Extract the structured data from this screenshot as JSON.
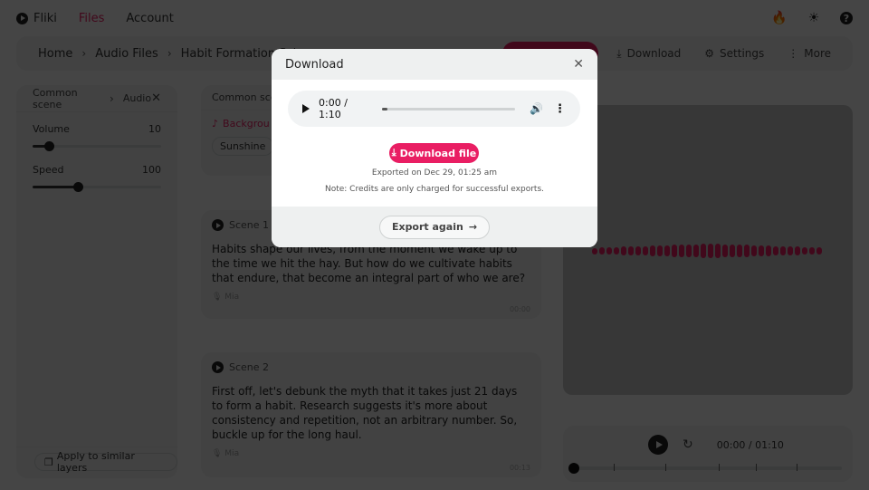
{
  "app": {
    "brand": "Fliki",
    "nav": [
      {
        "label": "Files",
        "active": true
      },
      {
        "label": "Account",
        "active": false
      }
    ],
    "top_icons": [
      "flame-icon",
      "sun-icon",
      "help-icon"
    ]
  },
  "breadcrumb": {
    "items": [
      "Home",
      "Audio Files",
      "Habit Formation Scien"
    ],
    "separator": "›",
    "actions": [
      {
        "label": "Download",
        "icon": "download-icon"
      },
      {
        "label": "Settings",
        "icon": "gear-icon"
      },
      {
        "label": "More",
        "icon": "more-vertical-icon"
      }
    ]
  },
  "left_panel": {
    "crumb": [
      "Common scene",
      "Audio"
    ],
    "close": "✕",
    "sliders": [
      {
        "label": "Volume",
        "value": "10",
        "fraction": 0.13
      },
      {
        "label": "Speed",
        "value": "100",
        "fraction": 0.35
      }
    ],
    "apply_button": "Apply to similar layers"
  },
  "common_card": {
    "title": "Common sce",
    "background_label": "Backgrou",
    "chip": "Sunshine"
  },
  "scenes": [
    {
      "title": "Scene 1",
      "text": "Habits shape our lives, from the moment we wake up to the time we hit the hay. But how do we cultivate habits that endure, that become an integral part of who we are?",
      "voice": "Mia",
      "time": "00:00"
    },
    {
      "title": "Scene 2",
      "text": "First off, let's debunk the myth that it takes just 21 days to form a habit. Research suggests it's more about consistency and repetition, not an arbitrary number. So, buckle up for the long haul.",
      "voice": "Mia",
      "time": "00:13"
    }
  ],
  "player": {
    "time": "00:00 / 01:10",
    "progress": 0,
    "scene_marks": [
      0.15,
      0.34,
      0.54,
      0.68,
      0.83
    ]
  },
  "modal": {
    "title": "Download",
    "close": "✕",
    "audio": {
      "time": "0:00 / 1:10",
      "progress": 0.04,
      "play": "▶",
      "volume": "🔊",
      "more": "⋮"
    },
    "download_button": "Download file",
    "exported": "Exported on Dec 29, 01:25 am",
    "note": "Note: Credits are only charged for successful exports.",
    "export_again": "Export again"
  },
  "colors": {
    "accent": "#e91e63"
  }
}
